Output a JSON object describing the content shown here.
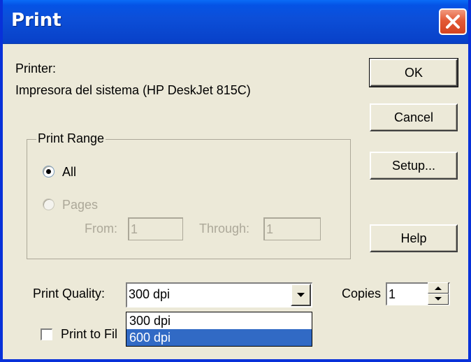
{
  "window": {
    "title": "Print"
  },
  "printer": {
    "label": "Printer:",
    "name": "Impresora del sistema (HP DeskJet 815C)"
  },
  "buttons": {
    "ok": "OK",
    "cancel": "Cancel",
    "setup": "Setup...",
    "help": "Help"
  },
  "print_range": {
    "title": "Print Range",
    "all_label": "All",
    "pages_label": "Pages",
    "from_label": "From:",
    "from_value": "1",
    "through_label": "Through:",
    "through_value": "1",
    "selected": "All"
  },
  "quality": {
    "label": "Print Quality:",
    "value": "300 dpi",
    "options": [
      "300 dpi",
      "600 dpi"
    ],
    "highlighted": "600 dpi"
  },
  "copies": {
    "label": "Copies",
    "value": "1"
  },
  "print_to_file": {
    "label": "Print to Fil",
    "checked": false
  },
  "icons": {
    "close": "close-icon",
    "dropdown": "chevron-down-icon",
    "spin_up": "arrow-up-icon",
    "spin_down": "arrow-down-icon"
  },
  "colors": {
    "title_bar": "#0a48d0",
    "dialog_bg": "#ece9d8",
    "selection": "#316ac5",
    "close_button": "#e35a36"
  }
}
